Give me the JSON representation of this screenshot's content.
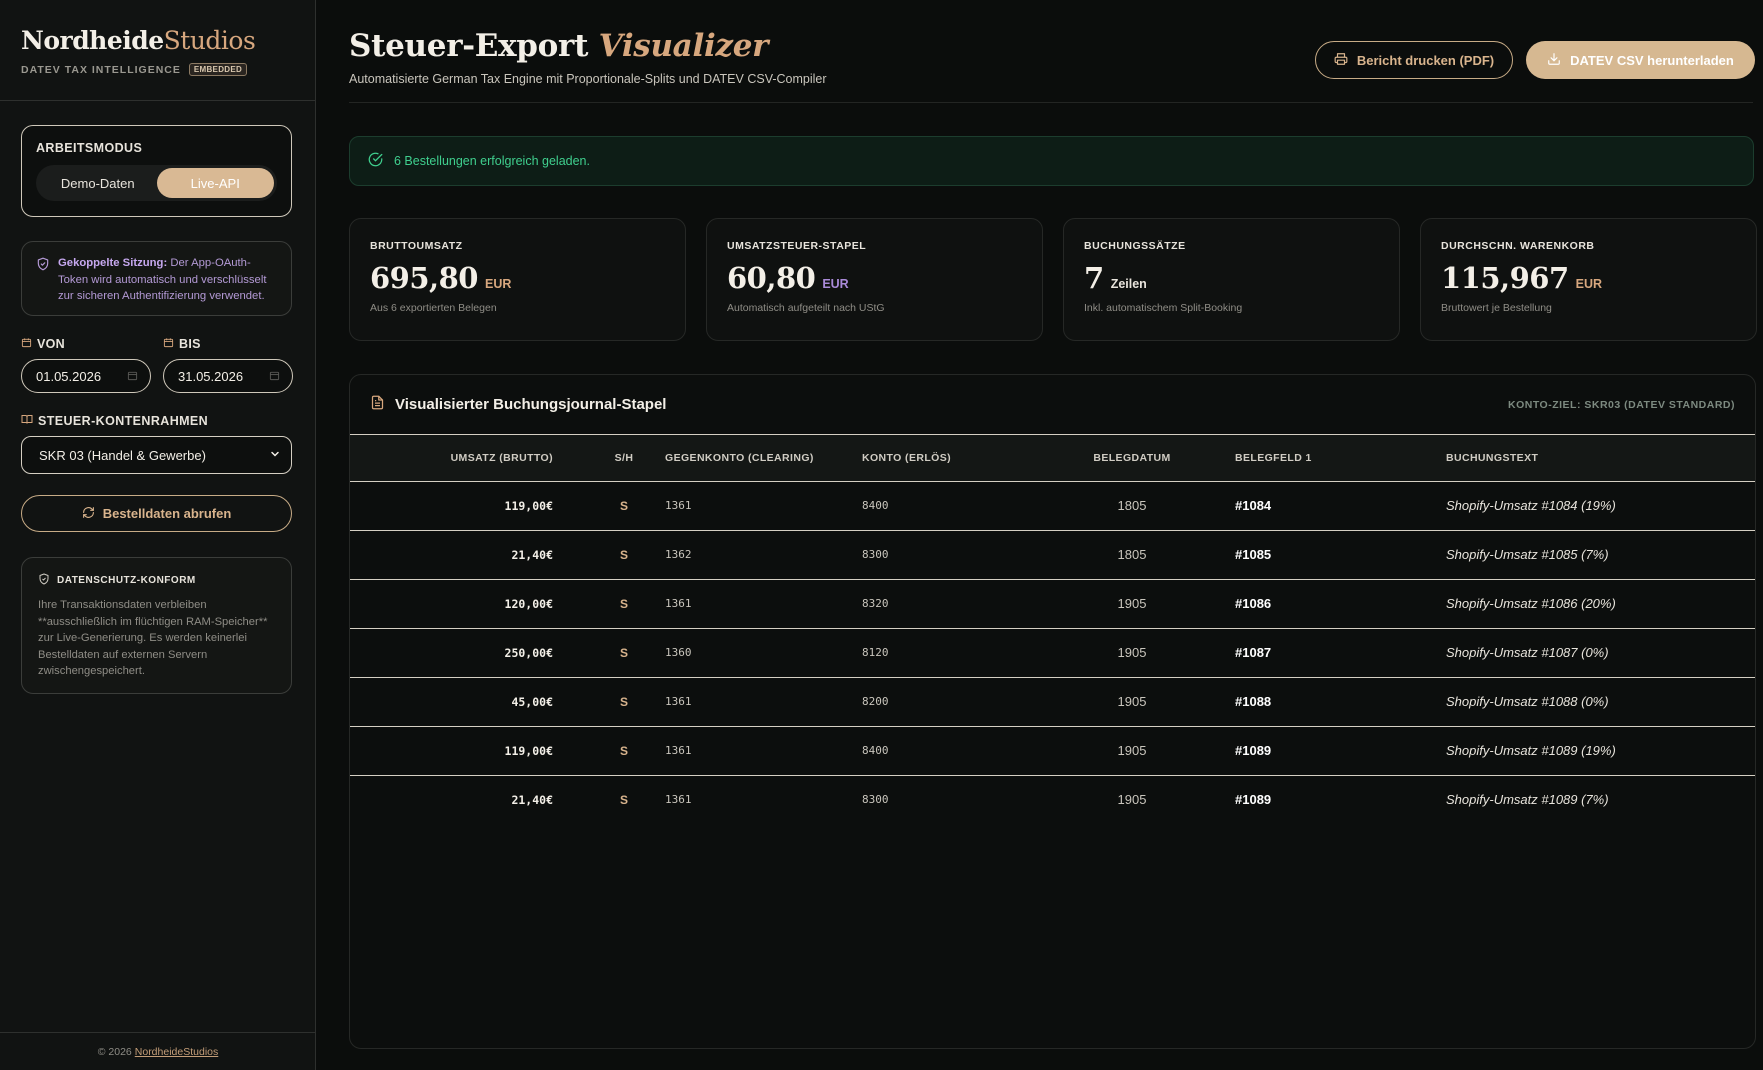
{
  "brand": {
    "part1": "Nordheide",
    "part2": "Studios",
    "subtitle": "DATEV TAX INTELLIGENCE",
    "badge": "EMBEDDED"
  },
  "sidebar": {
    "mode": {
      "label": "ARBEITSMODUS",
      "options": [
        "Demo-Daten",
        "Live-API"
      ],
      "selected": "Live-API"
    },
    "session": {
      "bold": "Gekoppelte Sitzung:",
      "text": " Der App-OAuth-Token wird automatisch und verschlüsselt zur sicheren Authentifizierung verwendet."
    },
    "dates": {
      "from_label": "VON",
      "to_label": "BIS",
      "from_value": "01.05.2026",
      "to_value": "31.05.2026"
    },
    "konto": {
      "label": "STEUER-KONTENRAHMEN",
      "selected": "SKR 03 (Handel & Gewerbe)"
    },
    "fetch_label": "Bestelldaten abrufen",
    "privacy": {
      "title": "DATENSCHUTZ-KONFORM",
      "text": "Ihre Transaktionsdaten verbleiben **ausschließlich im flüchtigen RAM-Speicher** zur Live-Generierung. Es werden keinerlei Bestelldaten auf externen Servern zwischengespeichert."
    },
    "footer": {
      "text": "© 2026",
      "link": "NordheideStudios"
    }
  },
  "header": {
    "title_part1": "Steuer-Export",
    "title_part2": "Visualizer",
    "subtitle": "Automatisierte German Tax Engine mit Proportionale-Splits und DATEV CSV-Compiler",
    "print_label": "Bericht drucken (PDF)",
    "csv_label": "DATEV CSV herunterladen"
  },
  "alert": {
    "text": "6 Bestellungen erfolgreich geladen."
  },
  "kpis": [
    {
      "label": "BRUTTOUMSATZ",
      "value": "695,80",
      "unit": "EUR",
      "sub": "Aus 6 exportierten Belegen",
      "unit_color": "#d7a77e"
    },
    {
      "label": "UMSATZSTEUER-STAPEL",
      "value": "60,80",
      "unit": "EUR",
      "sub": "Automatisch aufgeteilt nach UStG",
      "unit_color": "#a98ad8"
    },
    {
      "label": "BUCHUNGSSÄTZE",
      "value": "7",
      "unit": "Zeilen",
      "sub": "Inkl. automatischem Split-Booking",
      "unit_color": "#e8e4dc"
    },
    {
      "label": "DURCHSCHN. WARENKORB",
      "value": "115,967",
      "unit": "EUR",
      "sub": "Bruttowert je Bestellung",
      "unit_color": "#d7a77e"
    }
  ],
  "journal": {
    "title": "Visualisierter Buchungsjournal-Stapel",
    "meta": "KONTO-ZIEL: SKR03 (DATEV STANDARD)",
    "columns": [
      "UMSATZ (BRUTTO)",
      "S/H",
      "GEGENKONTO (CLEARING)",
      "KONTO (ERLÖS)",
      "BELEGDATUM",
      "BELEGFELD 1",
      "BUCHUNGSTEXT"
    ],
    "rows": [
      {
        "amount": "119,00€",
        "sh": "S",
        "gegenkonto": "1361",
        "konto": "8400",
        "datum": "1805",
        "beleg": "#1084",
        "text": "Shopify-Umsatz #1084 (19%)"
      },
      {
        "amount": "21,40€",
        "sh": "S",
        "gegenkonto": "1362",
        "konto": "8300",
        "datum": "1805",
        "beleg": "#1085",
        "text": "Shopify-Umsatz #1085 (7%)"
      },
      {
        "amount": "120,00€",
        "sh": "S",
        "gegenkonto": "1361",
        "konto": "8320",
        "datum": "1905",
        "beleg": "#1086",
        "text": "Shopify-Umsatz #1086 (20%)"
      },
      {
        "amount": "250,00€",
        "sh": "S",
        "gegenkonto": "1360",
        "konto": "8120",
        "datum": "1905",
        "beleg": "#1087",
        "text": "Shopify-Umsatz #1087 (0%)"
      },
      {
        "amount": "45,00€",
        "sh": "S",
        "gegenkonto": "1361",
        "konto": "8200",
        "datum": "1905",
        "beleg": "#1088",
        "text": "Shopify-Umsatz #1088 (0%)"
      },
      {
        "amount": "119,00€",
        "sh": "S",
        "gegenkonto": "1361",
        "konto": "8400",
        "datum": "1905",
        "beleg": "#1089",
        "text": "Shopify-Umsatz #1089 (19%)"
      },
      {
        "amount": "21,40€",
        "sh": "S",
        "gegenkonto": "1361",
        "konto": "8300",
        "datum": "1905",
        "beleg": "#1089",
        "text": "Shopify-Umsatz #1089 (7%)"
      }
    ]
  },
  "icons": {
    "session": "shield-icon",
    "calendar": "calendar-icon",
    "book": "book-icon",
    "refresh": "refresh-icon",
    "privacy": "shield-icon",
    "print": "printer-icon",
    "download": "download-icon",
    "success": "check-circle-icon",
    "document": "document-icon",
    "select": "chevron-down-icon"
  }
}
